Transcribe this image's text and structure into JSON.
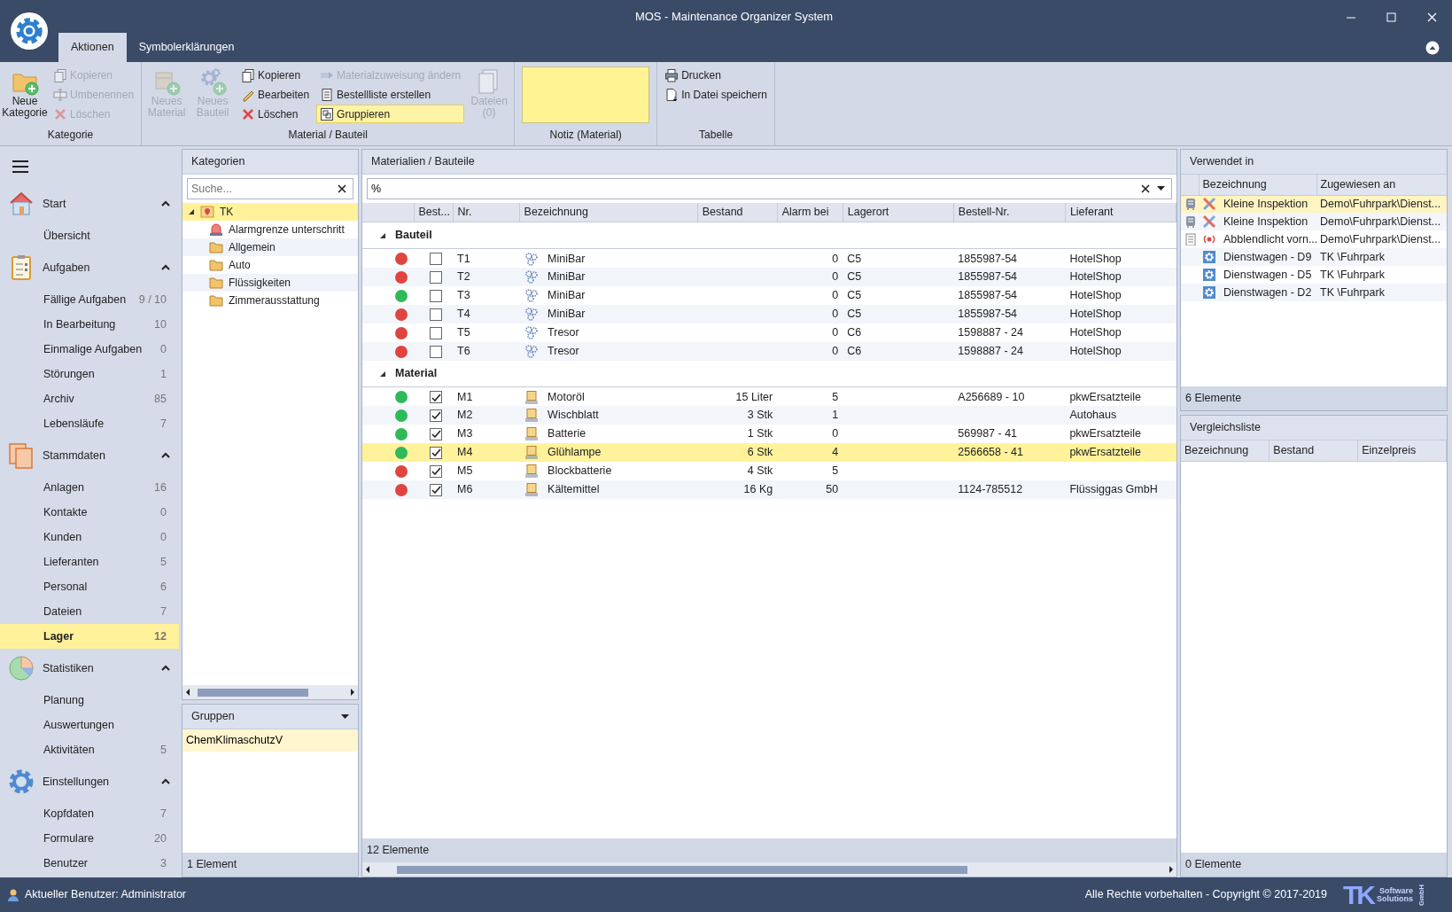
{
  "window": {
    "title": "MOS - Maintenance Organizer System"
  },
  "ribbon": {
    "tabs": [
      {
        "label": "Aktionen",
        "selected": true
      },
      {
        "label": "Symbolerklärungen",
        "selected": false
      }
    ],
    "groups": [
      {
        "label": "Kategorie",
        "items": [
          {
            "kind": "large",
            "label": "Neue Kategorie",
            "disabled": false
          },
          {
            "kind": "stack",
            "items": [
              {
                "label": "Kopieren",
                "disabled": true,
                "active": false
              },
              {
                "label": "Umbenennen",
                "disabled": true,
                "active": false
              },
              {
                "label": "Löschen",
                "disabled": true,
                "active": false
              }
            ]
          }
        ]
      },
      {
        "label": "Material / Bauteil",
        "items": [
          {
            "kind": "large",
            "label": "Neues Material",
            "disabled": true
          },
          {
            "kind": "large",
            "label": "Neues Bauteil",
            "disabled": true
          },
          {
            "kind": "stack",
            "items": [
              {
                "label": "Kopieren",
                "disabled": false,
                "active": false
              },
              {
                "label": "Bearbeiten",
                "disabled": false,
                "active": false
              },
              {
                "label": "Löschen",
                "disabled": false,
                "active": false
              }
            ]
          },
          {
            "kind": "stack",
            "items": [
              {
                "label": "Materialzuweisung ändern",
                "disabled": true,
                "active": false
              },
              {
                "label": "Bestellliste erstellen",
                "disabled": false,
                "active": false
              },
              {
                "label": "Gruppieren",
                "disabled": false,
                "active": true
              }
            ]
          },
          {
            "kind": "large",
            "label": "Dateien (0)",
            "disabled": true
          }
        ]
      },
      {
        "label": "Notiz (Material)",
        "items": [
          {
            "kind": "note"
          }
        ]
      },
      {
        "label": "Tabelle",
        "items": [
          {
            "kind": "stack",
            "items": [
              {
                "label": "Drucken",
                "disabled": false,
                "active": false
              },
              {
                "label": "In Datei speichern",
                "disabled": false,
                "active": false
              }
            ]
          }
        ]
      }
    ]
  },
  "sidebar": {
    "sections": [
      {
        "title": "Start",
        "expanded": true,
        "items": [
          {
            "label": "Übersicht",
            "selected": false
          }
        ]
      },
      {
        "title": "Aufgaben",
        "expanded": true,
        "items": [
          {
            "label": "Fällige Aufgaben",
            "count": "9 / 10",
            "selected": false
          },
          {
            "label": "In Bearbeitung",
            "count": "10",
            "selected": false
          },
          {
            "label": "Einmalige Aufgaben",
            "count": "0",
            "selected": false
          },
          {
            "label": "Störungen",
            "count": "1",
            "selected": false
          },
          {
            "label": "Archiv",
            "count": "85",
            "selected": false
          },
          {
            "label": "Lebensläufe",
            "count": "7",
            "selected": false
          }
        ]
      },
      {
        "title": "Stammdaten",
        "expanded": true,
        "items": [
          {
            "label": "Anlagen",
            "count": "16",
            "selected": false
          },
          {
            "label": "Kontakte",
            "count": "0",
            "selected": false
          },
          {
            "label": "Kunden",
            "count": "0",
            "selected": false
          },
          {
            "label": "Lieferanten",
            "count": "5",
            "selected": false
          },
          {
            "label": "Personal",
            "count": "6",
            "selected": false
          },
          {
            "label": "Dateien",
            "count": "7",
            "selected": false
          },
          {
            "label": "Lager",
            "count": "12",
            "selected": true
          }
        ]
      },
      {
        "title": "Statistiken",
        "expanded": true,
        "items": [
          {
            "label": "Planung",
            "selected": false
          },
          {
            "label": "Auswertungen",
            "selected": false
          },
          {
            "label": "Aktivitäten",
            "count": "5",
            "selected": false
          }
        ]
      },
      {
        "title": "Einstellungen",
        "expanded": true,
        "items": [
          {
            "label": "Kopfdaten",
            "count": "7",
            "selected": false
          },
          {
            "label": "Formulare",
            "count": "20",
            "selected": false
          },
          {
            "label": "Benutzer",
            "count": "3",
            "selected": false
          }
        ]
      }
    ]
  },
  "categories": {
    "title": "Kategorien",
    "search": {
      "placeholder": "Suche..."
    },
    "tree": [
      {
        "label": "TK",
        "kind": "root",
        "selected": true,
        "expanded": true,
        "children": [
          {
            "label": "Alarmgrenze unterschritt",
            "kind": "alarm",
            "selected": false
          },
          {
            "label": "Allgemein",
            "kind": "folder",
            "selected": false
          },
          {
            "label": "Auto",
            "kind": "folder",
            "selected": false
          },
          {
            "label": "Flüssigkeiten",
            "kind": "folder",
            "selected": false
          },
          {
            "label": "Zimmerausstattung",
            "kind": "folder",
            "selected": false
          }
        ]
      }
    ]
  },
  "groups_panel": {
    "title": "Gruppen",
    "items": [
      {
        "label": "ChemKlimaschutzV",
        "selected": true
      }
    ],
    "footer": "1 Element"
  },
  "materials": {
    "title": "Materialien / Bauteile",
    "filter": {
      "value": "%"
    },
    "columns": [
      "Best...",
      "Nr.",
      "Bezeichnung",
      "Bestand",
      "Alarm bei",
      "Lagerort",
      "Bestell-Nr.",
      "Lieferant"
    ],
    "groups": [
      {
        "label": "Bauteil",
        "kind": "part",
        "expanded": true,
        "rows": [
          {
            "color": "#e0443e",
            "checked": false,
            "nr": "T1",
            "name": "MiniBar",
            "alarm": "0",
            "location": "C5",
            "order_no": "1855987-54",
            "supplier": "HotelShop",
            "selected": false
          },
          {
            "color": "#e0443e",
            "checked": false,
            "nr": "T2",
            "name": "MiniBar",
            "alarm": "0",
            "location": "C5",
            "order_no": "1855987-54",
            "supplier": "HotelShop",
            "selected": false
          },
          {
            "color": "#2fba5a",
            "checked": false,
            "nr": "T3",
            "name": "MiniBar",
            "alarm": "0",
            "location": "C5",
            "order_no": "1855987-54",
            "supplier": "HotelShop",
            "selected": false
          },
          {
            "color": "#e0443e",
            "checked": false,
            "nr": "T4",
            "name": "MiniBar",
            "alarm": "0",
            "location": "C5",
            "order_no": "1855987-54",
            "supplier": "HotelShop",
            "selected": false
          },
          {
            "color": "#e0443e",
            "checked": false,
            "nr": "T5",
            "name": "Tresor",
            "alarm": "0",
            "location": "C6",
            "order_no": "1598887 - 24",
            "supplier": "HotelShop",
            "selected": false
          },
          {
            "color": "#e0443e",
            "checked": false,
            "nr": "T6",
            "name": "Tresor",
            "alarm": "0",
            "location": "C6",
            "order_no": "1598887 - 24",
            "supplier": "HotelShop",
            "selected": false
          }
        ]
      },
      {
        "label": "Material",
        "kind": "material",
        "expanded": true,
        "rows": [
          {
            "color": "#2fba5a",
            "checked": true,
            "nr": "M1",
            "name": "Motoröl",
            "stock": "15 Liter",
            "alarm": "5",
            "order_no": "A256689 - 10",
            "supplier": "pkwErsatzteile",
            "selected": false
          },
          {
            "color": "#2fba5a",
            "checked": true,
            "nr": "M2",
            "name": "Wischblatt",
            "stock": "3 Stk",
            "alarm": "1",
            "supplier": "Autohaus",
            "selected": false
          },
          {
            "color": "#2fba5a",
            "checked": true,
            "nr": "M3",
            "name": "Batterie",
            "stock": "1 Stk",
            "alarm": "0",
            "order_no": "569987 - 41",
            "supplier": "pkwErsatzteile",
            "selected": false
          },
          {
            "color": "#2fba5a",
            "checked": true,
            "nr": "M4",
            "name": "Glühlampe",
            "stock": "6 Stk",
            "alarm": "4",
            "order_no": "2566658 - 41",
            "supplier": "pkwErsatzteile",
            "selected": true
          },
          {
            "color": "#e0443e",
            "checked": true,
            "nr": "M5",
            "name": "Blockbatterie",
            "stock": "4 Stk",
            "alarm": "5",
            "selected": false
          },
          {
            "color": "#e0443e",
            "checked": true,
            "nr": "M6",
            "name": "Kältemittel",
            "stock": "16 Kg",
            "alarm": "50",
            "order_no": "1124-785512",
            "supplier": "Flüssiggas GmbH",
            "selected": false
          }
        ]
      }
    ],
    "footer": "12 Elemente"
  },
  "used_in": {
    "title": "Verwendet in",
    "columns": [
      "Bezeichnung",
      "Zugewiesen an"
    ],
    "rows": [
      {
        "kind": "task",
        "name": "Kleine Inspektion",
        "assigned": "Demo\\Fuhrpark\\Dienst...",
        "selected": true
      },
      {
        "kind": "task",
        "name": "Kleine Inspektion",
        "assigned": "Demo\\Fuhrpark\\Dienst...",
        "selected": false
      },
      {
        "kind": "fault",
        "name": "Abblendlicht vorn...",
        "assigned": "Demo\\Fuhrpark\\Dienst...",
        "selected": false
      },
      {
        "kind": "asset",
        "name": "Dienstwagen - D9",
        "assigned": "TK \\Fuhrpark",
        "selected": false
      },
      {
        "kind": "asset",
        "name": "Dienstwagen - D5",
        "assigned": "TK \\Fuhrpark",
        "selected": false
      },
      {
        "kind": "asset",
        "name": "Dienstwagen - D2",
        "assigned": "TK \\Fuhrpark",
        "selected": false
      }
    ],
    "footer": "6 Elemente"
  },
  "comparison": {
    "title": "Vergleichsliste",
    "columns": [
      "Bezeichnung",
      "Bestand",
      "Einzelpreis"
    ],
    "footer": "0 Elemente"
  },
  "status_bar": {
    "user": "Aktueller Benutzer: Administrator",
    "copyright": "Alle Rechte vorbehalten - Copyright © 2017-2019",
    "logo": {
      "mark": "TK",
      "line_1": "Software",
      "line_2": "Solutions",
      "suffix": "GmbH"
    }
  }
}
